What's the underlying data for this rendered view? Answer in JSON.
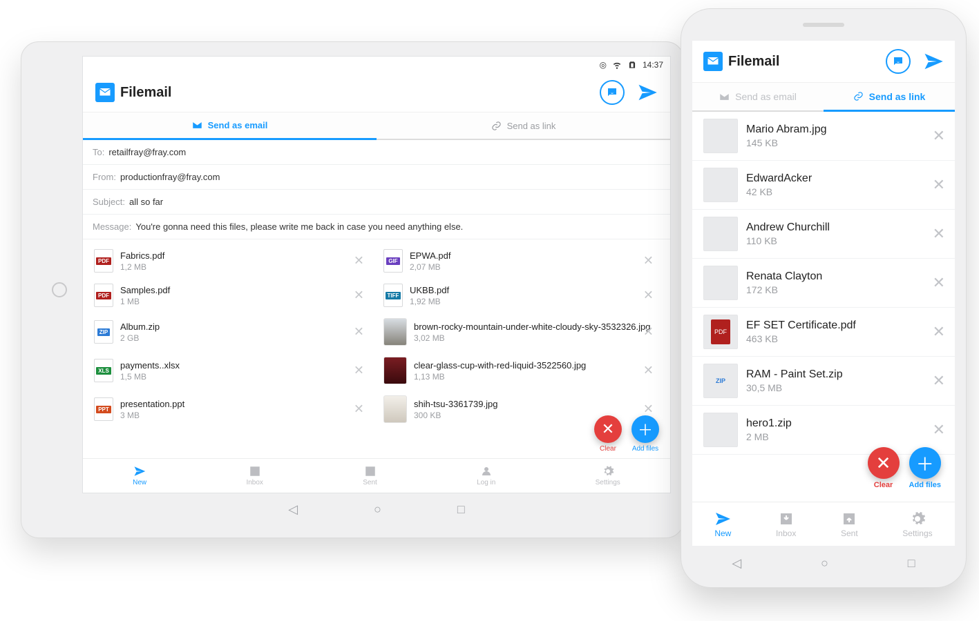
{
  "brand": "Filemail",
  "statusbar": {
    "time": "14:37"
  },
  "header": {
    "support_icon": "support",
    "send_icon": "send"
  },
  "tabs": {
    "email": "Send as email",
    "link": "Send as link"
  },
  "form": {
    "to_label": "To:",
    "to_value": "retailfray@fray.com",
    "from_label": "From:",
    "from_value": "productionfray@fray.com",
    "subject_label": "Subject:",
    "subject_value": "all so far",
    "message_label": "Message:",
    "message_value": "You're gonna need this files, please write me back in case you need anything else."
  },
  "files_left": [
    {
      "name": "Fabrics.pdf",
      "size": "1,2 MB",
      "type": "pdf"
    },
    {
      "name": "Samples.pdf",
      "size": "1 MB",
      "type": "pdf"
    },
    {
      "name": "Album.zip",
      "size": "2 GB",
      "type": "zip"
    },
    {
      "name": "payments..xlsx",
      "size": "1,5 MB",
      "type": "xls"
    },
    {
      "name": "presentation.ppt",
      "size": "3 MB",
      "type": "ppt"
    }
  ],
  "files_right": [
    {
      "name": "EPWA.pdf",
      "size": "2,07 MB",
      "type": "gif"
    },
    {
      "name": "UKBB.pdf",
      "size": "1,92 MB",
      "type": "tiff"
    },
    {
      "name": "brown-rocky-mountain-under-white-cloudy-sky-3532326.jpg",
      "size": "3,02 MB",
      "type": "img-a"
    },
    {
      "name": "clear-glass-cup-with-red-liquid-3522560.jpg",
      "size": "1,13 MB",
      "type": "img-b"
    },
    {
      "name": "shih-tsu-3361739.jpg",
      "size": "300 KB",
      "type": "img-c"
    }
  ],
  "fab": {
    "clear": "Clear",
    "add": "Add files"
  },
  "tabbar": {
    "new": "New",
    "inbox": "Inbox",
    "sent": "Sent",
    "login": "Log in",
    "settings": "Settings"
  },
  "phone": {
    "files": [
      {
        "name": "Mario Abram.jpg",
        "size": "145 KB",
        "thumb": "avatar1"
      },
      {
        "name": "EdwardAcker",
        "size": "42 KB",
        "thumb": "avatar2"
      },
      {
        "name": "Andrew Churchill",
        "size": "110 KB",
        "thumb": "avatar3"
      },
      {
        "name": "Renata Clayton",
        "size": "172 KB",
        "thumb": "avatar4"
      },
      {
        "name": "EF SET Certificate.pdf",
        "size": "463 KB",
        "thumb": "pdfthumb"
      },
      {
        "name": "RAM - Paint Set.zip",
        "size": "30,5 MB",
        "thumb": "zipthumb"
      },
      {
        "name": "hero1.zip",
        "size": "2 MB",
        "thumb": "filegen"
      }
    ]
  }
}
